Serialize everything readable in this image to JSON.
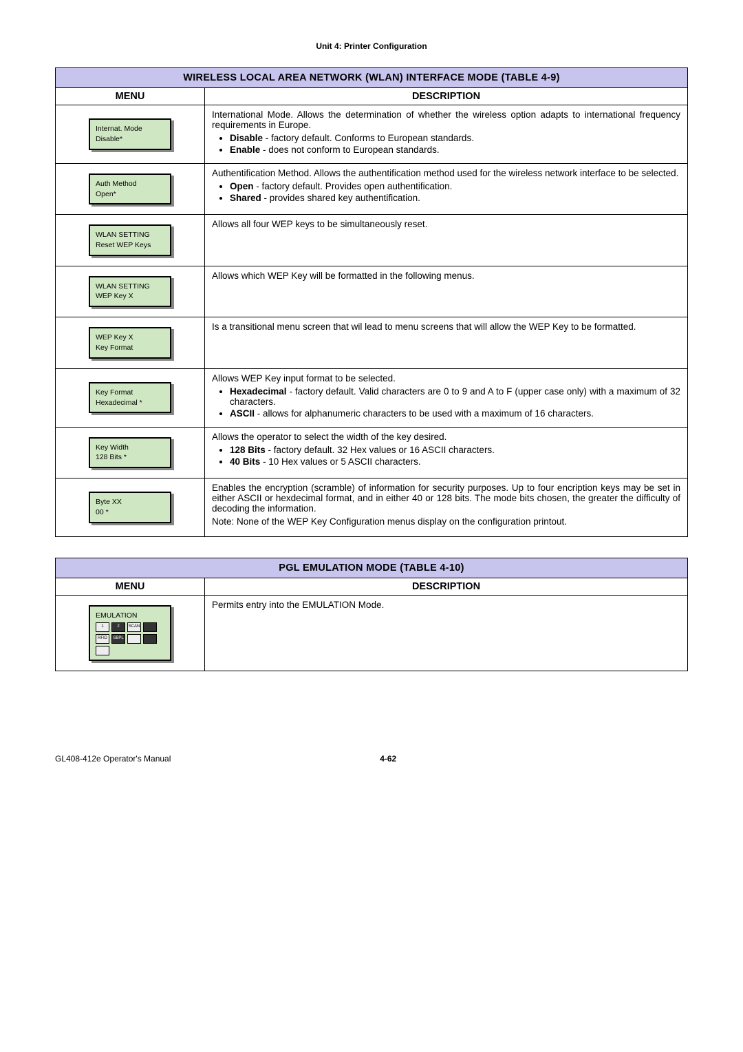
{
  "unit_header": "Unit 4:  Printer Configuration",
  "table1": {
    "title": "WIRELESS LOCAL AREA NETWORK (WLAN) INTERFACE MODE (TABLE 4-9)",
    "menu_hdr": "MENU",
    "desc_hdr": "DESCRIPTION",
    "rows": [
      {
        "lcd1": "Internat. Mode",
        "lcd2": "Disable*",
        "intro": "International Mode. Allows the determination of whether the wireless option adapts to international frequency requirements in Europe.",
        "opts": [
          {
            "b": "Disable",
            "t": " - factory default. Conforms to European standards."
          },
          {
            "b": "Enable",
            "t": " - does not conform to European standards."
          }
        ]
      },
      {
        "lcd1": "Auth Method",
        "lcd2": "Open*",
        "intro": "Authentification Method. Allows the authentification method used for the wireless network interface to be selected.",
        "opts": [
          {
            "b": "Open",
            "t": " - factory default. Provides open authentification."
          },
          {
            "b": "Shared",
            "t": " - provides shared key authentification."
          }
        ]
      },
      {
        "lcd1": "WLAN SETTING",
        "lcd2": "Reset WEP Keys",
        "intro": "Allows all four WEP keys to be simultaneously reset.",
        "opts": []
      },
      {
        "lcd1": "WLAN SETTING",
        "lcd2": "WEP Key X",
        "intro": "Allows which WEP Key will be formatted in the following menus.",
        "opts": []
      },
      {
        "lcd1": "WEP Key X",
        "lcd2": "Key Format",
        "intro": "Is a transitional menu screen that wil lead to menu screens that will allow the WEP Key to be formatted.",
        "opts": []
      },
      {
        "lcd1": "Key Format",
        "lcd2": "Hexadecimal *",
        "intro": "Allows WEP Key input format to be selected.",
        "opts": [
          {
            "b": "Hexadecimal",
            "t": " - factory default. Valid characters are 0 to 9 and A to F (upper case only) with a maximum of 32 characters."
          },
          {
            "b": "ASCII",
            "t": " - allows for alphanumeric characters to be used with a maximum of 16 characters."
          }
        ]
      },
      {
        "lcd1": "Key Width",
        "lcd2": "128 Bits *",
        "intro": "Allows the operator to select the width of the key desired.",
        "opts": [
          {
            "b": "128 Bits",
            "t": " - factory default. 32 Hex values or 16 ASCII characters."
          },
          {
            "b": "40 Bits",
            "t": " - 10 Hex values or 5 ASCII characters."
          }
        ]
      },
      {
        "lcd1": "Byte XX",
        "lcd2": "00 *",
        "intro": "Enables the encryption (scramble) of information for security purposes. Up to four encription keys may be set in either ASCII or hexdecimal format, and in either 40 or 128 bits. The mode bits chosen, the greater the difficulty of decoding the information.",
        "note": "Note: None of the WEP Key Configuration menus display on the configuration printout.",
        "opts": []
      }
    ]
  },
  "table2": {
    "title": "PGL EMULATION MODE (TABLE 4-10)",
    "menu_hdr": "MENU",
    "desc_hdr": "DESCRIPTION",
    "rows": [
      {
        "lcd1": "EMULATION",
        "intro": "Permits entry into the EMULATION Mode.",
        "icons": [
          "1",
          "2",
          "SCAN",
          "",
          "RFID",
          "SBPL",
          "",
          "",
          ""
        ]
      }
    ]
  },
  "footer": {
    "left": "GL408-412e Operator's Manual",
    "page": "4-62"
  }
}
